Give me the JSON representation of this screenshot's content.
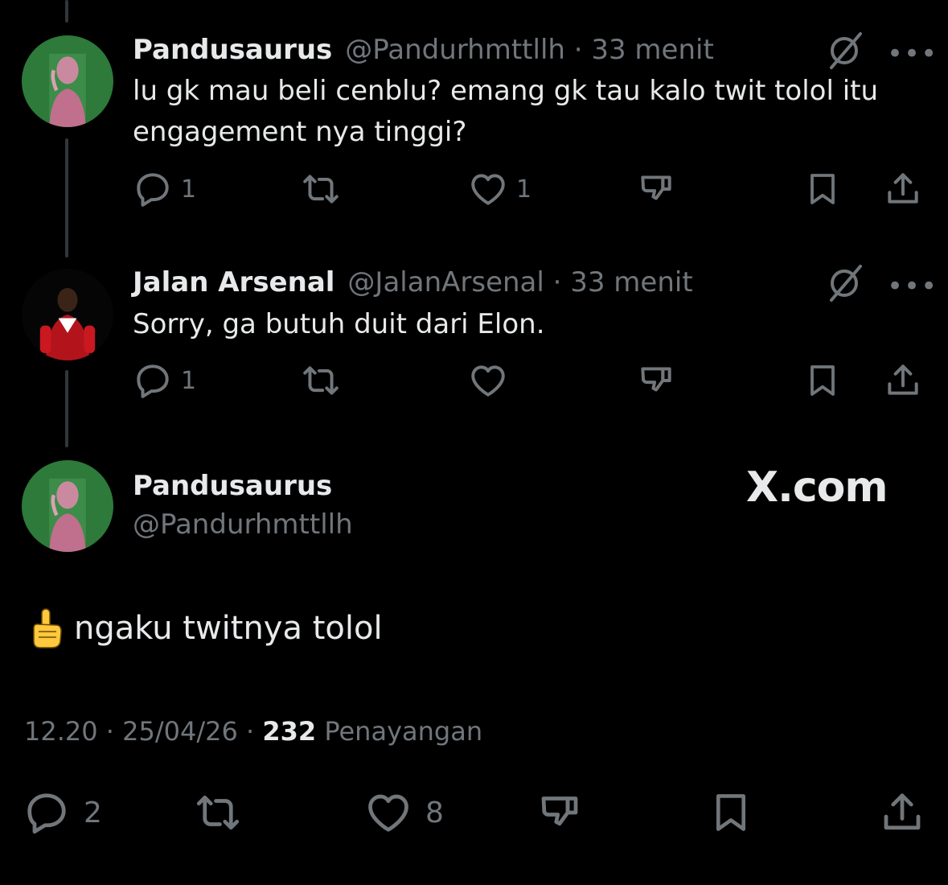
{
  "tweets": [
    {
      "display_name": "Pandusaurus",
      "handle_meta": "@Pandurhmttllh · 33 menit",
      "text": "lu gk mau beli cenblu? emang gk tau kalo twit tolol itu engagement nya tinggi?",
      "reply_count": "1",
      "like_count": "1",
      "more": "•••"
    },
    {
      "display_name": "Jalan Arsenal",
      "handle_meta": "@JalanArsenal · 33 menit",
      "text": "Sorry, ga butuh duit dari Elon.",
      "reply_count": "1",
      "like_count": "",
      "more": "•••"
    }
  ],
  "main_tweet": {
    "display_name": "Pandusaurus",
    "handle": "@Pandurhmttllh",
    "watermark": "X.com",
    "text": "ngaku twitnya tolol",
    "time_date": "12.20 · 25/04/26 · ",
    "views_count": "232",
    "views_label": " Penayangan",
    "reply_count": "2",
    "like_count": "8"
  },
  "colors": {
    "background": "#000000",
    "text_primary": "#e7e9ea",
    "text_secondary": "#71767b",
    "thread_line": "#333639",
    "avatar_green": "#2d7a3a"
  }
}
